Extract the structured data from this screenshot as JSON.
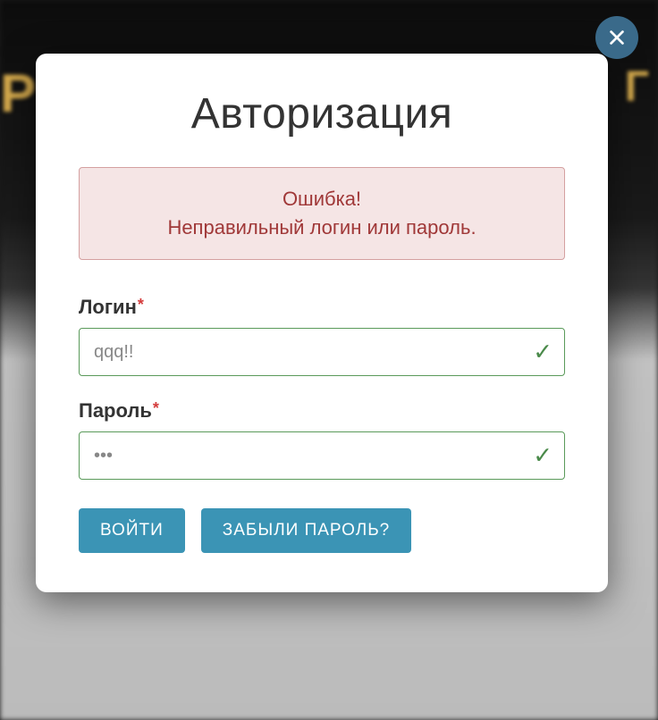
{
  "modal": {
    "title": "Авторизация",
    "close_icon": "close"
  },
  "alert": {
    "title": "Ошибка!",
    "message": "Неправильный логин или пароль."
  },
  "form": {
    "login": {
      "label": "Логин",
      "value": "qqq!!",
      "required_mark": "*"
    },
    "password": {
      "label": "Пароль",
      "value": "•••",
      "required_mark": "*"
    }
  },
  "buttons": {
    "submit": "ВОЙТИ",
    "forgot": "ЗАБЫЛИ ПАРОЛЬ?"
  }
}
